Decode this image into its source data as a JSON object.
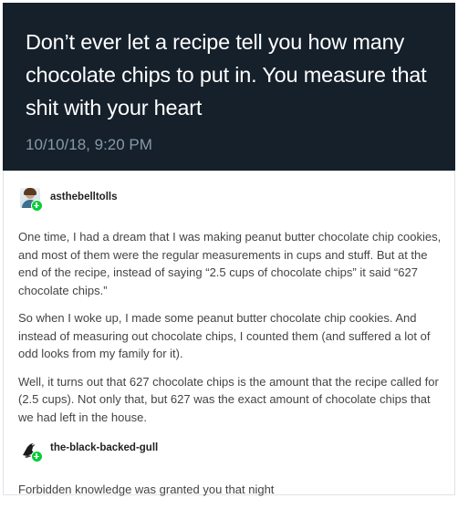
{
  "tweet": {
    "text": "Don’t ever let a recipe tell you how many chocolate chips to put in. You measure that shit with your heart",
    "timestamp": "10/10/18, 9:20 PM"
  },
  "posts": [
    {
      "username": "asthebelltolls",
      "avatar_icon": "user-avatar-icon",
      "badge_icon": "follow-plus-icon",
      "paragraphs": [
        "One time, I had a dream that I was making peanut butter chocolate chip cookies, and most of them were the regular measurements in cups and stuff. But at the end of the recipe, instead of saying “2.5 cups of chocolate chips” it said “627 chocolate chips.”",
        "So when I woke up, I made some peanut butter chocolate chip cookies. And instead of measuring out chocolate chips, I counted them (and suffered a lot of odd looks from my family for it).",
        "Well, it turns out that 627 chocolate chips is the amount that the recipe called for (2.5 cups). Not only that, but 627 was the exact amount of chocolate chips that we had left in the house."
      ]
    },
    {
      "username": "the-black-backed-gull",
      "avatar_icon": "bird-avatar-icon",
      "badge_icon": "follow-plus-icon",
      "paragraphs": [
        "Forbidden knowledge was granted you that night"
      ]
    }
  ],
  "colors": {
    "tweet_background": "#15202b",
    "tweet_text": "#ffffff",
    "tweet_timestamp": "#8899a6",
    "post_text": "#444444",
    "badge": "#00cf35"
  }
}
